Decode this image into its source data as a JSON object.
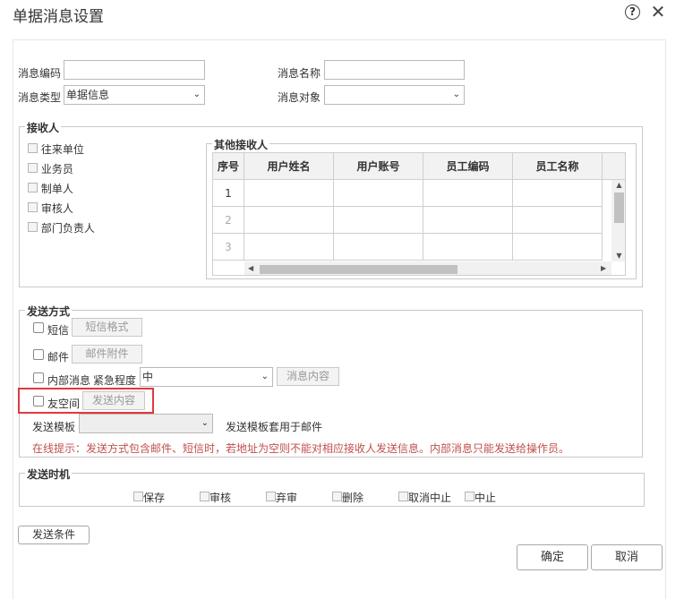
{
  "window": {
    "title": "单据消息设置",
    "help_icon": "?",
    "close_icon": "✕"
  },
  "form": {
    "msg_code": {
      "label": "消息编码",
      "value": ""
    },
    "msg_name": {
      "label": "消息名称",
      "value": ""
    },
    "msg_type": {
      "label": "消息类型",
      "value": "单据信息"
    },
    "msg_target": {
      "label": "消息对象",
      "value": ""
    }
  },
  "recipients": {
    "legend": "接收人",
    "options": [
      "往来单位",
      "业务员",
      "制单人",
      "审核人",
      "部门负责人"
    ],
    "others": {
      "legend": "其他接收人",
      "columns": [
        "序号",
        "用户姓名",
        "用户账号",
        "员工编码",
        "员工名称"
      ],
      "rows": [
        "1",
        "2",
        "3"
      ]
    }
  },
  "send_method": {
    "legend": "发送方式",
    "sms": {
      "label": "短信",
      "button": "短信格式"
    },
    "email": {
      "label": "邮件",
      "button": "邮件附件"
    },
    "internal": {
      "label": "内部消息",
      "urgency_label": "紧急程度",
      "urgency_value": "中",
      "button": "消息内容"
    },
    "friend": {
      "label": "友空间",
      "button": "发送内容"
    },
    "template": {
      "label": "发送模板",
      "value": "",
      "note": "发送模板套用于邮件"
    },
    "tip": "在线提示：发送方式包含邮件、短信时，若地址为空则不能对相应接收人发送信息。内部消息只能发送给操作员。"
  },
  "send_timing": {
    "legend": "发送时机",
    "options": [
      "保存",
      "审核",
      "弃审",
      "删除",
      "取消中止",
      "中止"
    ]
  },
  "buttons": {
    "condition": "发送条件",
    "ok": "确定",
    "cancel": "取消"
  },
  "colors": {
    "highlight": "#e0383e",
    "tip": "#c0504d"
  }
}
